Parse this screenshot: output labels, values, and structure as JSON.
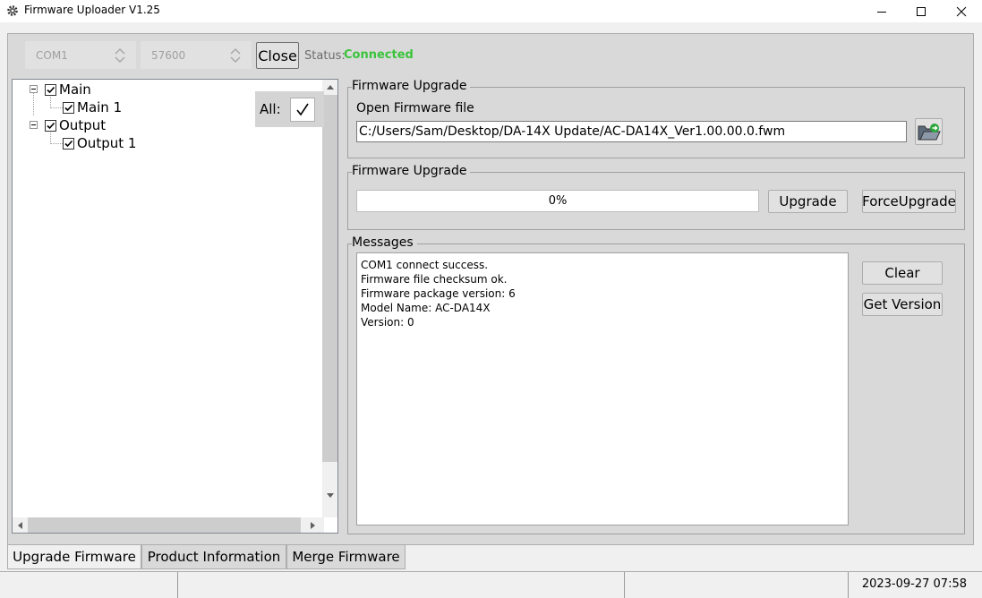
{
  "window": {
    "title": "Firmware Uploader V1.25"
  },
  "connection": {
    "port": "COM1",
    "baud": "57600",
    "close_label": "Close",
    "status_label": "Status:",
    "status_value": "Connected",
    "status_color": "#3bc33b"
  },
  "tree": {
    "all_label": "All:",
    "nodes": [
      {
        "label": "Main",
        "checked": true,
        "children": [
          {
            "label": "Main 1",
            "checked": true
          }
        ]
      },
      {
        "label": "Output",
        "checked": true,
        "children": [
          {
            "label": "Output 1",
            "checked": true
          }
        ]
      }
    ]
  },
  "firmware_file": {
    "group_title": "Firmware Upgrade",
    "open_label": "Open Firmware file",
    "path": "C:/Users/Sam/Desktop/DA-14X Update/AC-DA14X_Ver1.00.00.0.fwm",
    "browse_icon": "folder-open-icon"
  },
  "upgrade": {
    "group_title": "Firmware Upgrade",
    "progress_value": 0,
    "progress_text": "0%",
    "upgrade_label": "Upgrade",
    "force_label": "ForceUpgrade"
  },
  "messages": {
    "group_title": "Messages",
    "lines": [
      "COM1 connect success.",
      "Firmware file checksum ok.",
      "Firmware package version: 6",
      "Model Name: AC-DA14X",
      "Version: 0"
    ],
    "clear_label": "Clear",
    "get_version_label": "Get Version"
  },
  "tabs": [
    {
      "label": "Upgrade Firmware",
      "active": true
    },
    {
      "label": "Product Information",
      "active": false
    },
    {
      "label": "Merge Firmware",
      "active": false
    }
  ],
  "statusbar": {
    "datetime": "2023-09-27 07:58"
  }
}
